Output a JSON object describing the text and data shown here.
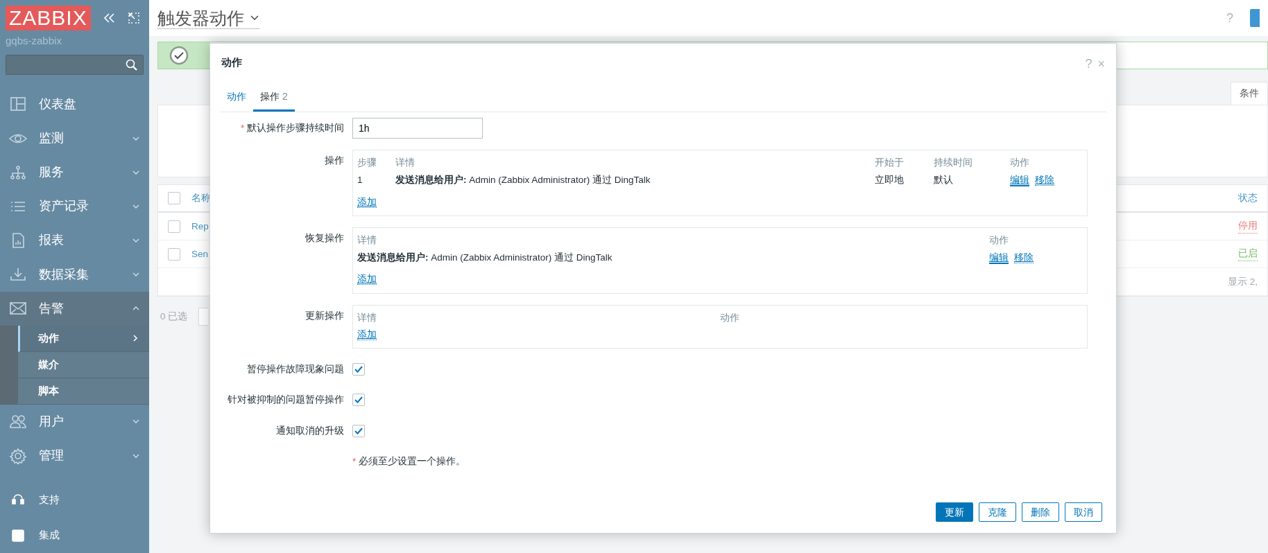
{
  "sidebar": {
    "logo": "ZABBIX",
    "server": "gqbs-zabbix",
    "menu": [
      {
        "label": "仪表盘",
        "expandable": false,
        "expanded": false
      },
      {
        "label": "监测",
        "expandable": true,
        "expanded": false
      },
      {
        "label": "服务",
        "expandable": true,
        "expanded": false
      },
      {
        "label": "资产记录",
        "expandable": true,
        "expanded": false
      },
      {
        "label": "报表",
        "expandable": true,
        "expanded": false
      },
      {
        "label": "数据采集",
        "expandable": true,
        "expanded": false
      },
      {
        "label": "告警",
        "expandable": true,
        "expanded": true,
        "children": [
          {
            "label": "动作",
            "selected": true
          },
          {
            "label": "媒介",
            "selected": false
          },
          {
            "label": "脚本",
            "selected": false
          }
        ]
      },
      {
        "label": "用户",
        "expandable": true,
        "expanded": false
      },
      {
        "label": "管理",
        "expandable": true,
        "expanded": false
      }
    ],
    "bottom": [
      {
        "label": "支持"
      },
      {
        "label": "集成"
      }
    ]
  },
  "page": {
    "title": "触发器动作",
    "help": "?",
    "filter_tab": "条件",
    "table": {
      "all_checked": false,
      "column_1": "名称",
      "column_2": "状态",
      "rows": [
        {
          "checked": false,
          "name": "Rep",
          "status": "停用",
          "color": "#e87b7b"
        },
        {
          "checked": false,
          "name": "Sen",
          "status": "已启",
          "color": "#6fb85e"
        }
      ],
      "footer": "显示 2,"
    },
    "selected_count": "0 已选"
  },
  "dialog": {
    "title": "动作",
    "help": "?",
    "close": "×",
    "tabs": [
      {
        "label": "动作",
        "selected": false
      },
      {
        "label": "操作",
        "count": "2",
        "selected": true
      }
    ],
    "duration": {
      "required_mark": "*",
      "label": "默认操作步骤持续时间",
      "value": "1h"
    },
    "operations": {
      "label": "操作",
      "columns": [
        "步骤",
        "详情",
        "开始于",
        "持续时间",
        "动作"
      ],
      "rows": [
        {
          "step": "1",
          "details": "**发送消息给用户:** Admin (Zabbix Administrator) 通过 DingTalk",
          "start": "立即地",
          "duration": "默认",
          "actions": [
            "编辑",
            "移除"
          ]
        }
      ],
      "add": "添加"
    },
    "recovery": {
      "label": "恢复操作",
      "columns": [
        "详情",
        "动作"
      ],
      "rows": [
        {
          "details": "**发送消息给用户:** Admin (Zabbix Administrator) 通过 DingTalk",
          "actions": [
            "编辑",
            "移除"
          ]
        }
      ],
      "add": "添加"
    },
    "update": {
      "label": "更新操作",
      "columns": [
        "详情",
        "动作"
      ],
      "add": "添加"
    },
    "checkboxes": [
      {
        "label": "暂停操作故障现象问题",
        "checked": true
      },
      {
        "label": "针对被抑制的问题暂停操作",
        "checked": true
      },
      {
        "label": "通知取消的升级",
        "checked": true
      }
    ],
    "note": {
      "required_mark": "*",
      "text": "必须至少设置一个操作。"
    },
    "buttons": [
      {
        "label": "更新",
        "kind": "primary"
      },
      {
        "label": "克隆",
        "kind": "secondary"
      },
      {
        "label": "删除",
        "kind": "secondary"
      },
      {
        "label": "取消",
        "kind": "secondary"
      }
    ]
  }
}
